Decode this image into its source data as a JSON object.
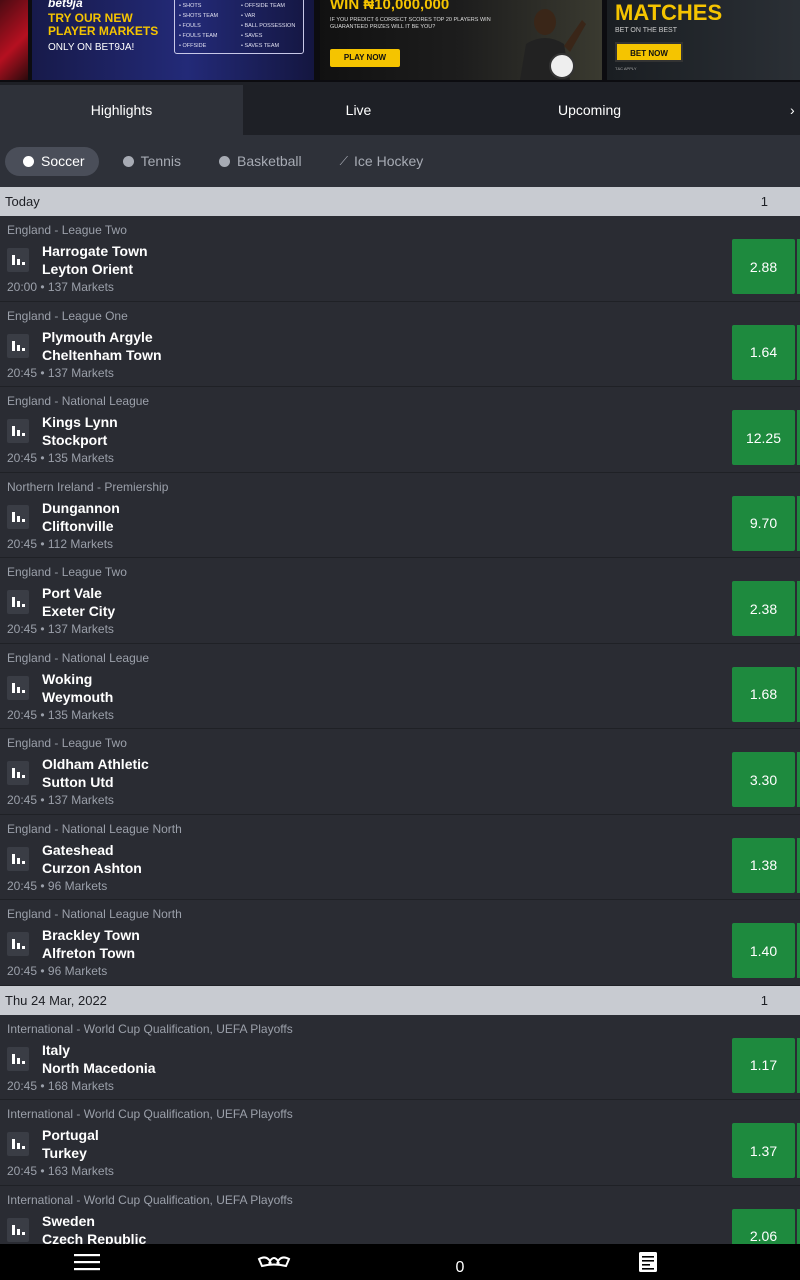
{
  "banner": {
    "ad1": {
      "brand": "bet9ja",
      "headline": "TRY OUR NEW PLAYER MARKETS",
      "subline": "ONLY ON BET9JA!",
      "markets": [
        "• SHOTS",
        "• OFFSIDE TEAM",
        "• SHOTS TEAM",
        "• VAR",
        "• FOULS",
        "• BALL POSSESSION",
        "• FOULS TEAM",
        "• SAVES",
        "• OFFSIDE",
        "• SAVES TEAM"
      ]
    },
    "ad2": {
      "headline": "WIN ₦10,000,000",
      "subline": "IF YOU PREDICT 6 CORRECT SCORES TOP 20 PLAYERS WIN GUARANTEED PRIZES WILL IT BE YOU?",
      "cta": "PLAY NOW"
    },
    "ad3": {
      "headline": "MATCHES",
      "subline": "BET ON THE BEST",
      "cta": "BET NOW",
      "fine_print": "T&C APPLY"
    }
  },
  "tabs": [
    "Highlights",
    "Live",
    "Upcoming"
  ],
  "sports": [
    {
      "label": "Soccer",
      "icon": "soccer-ball-icon"
    },
    {
      "label": "Tennis",
      "icon": "tennis-ball-icon"
    },
    {
      "label": "Basketball",
      "icon": "basketball-icon"
    },
    {
      "label": "Ice Hockey",
      "icon": "hockey-stick-icon"
    }
  ],
  "groups": [
    {
      "date": "Today",
      "col": "1",
      "matches": [
        {
          "league": "England - League Two",
          "home": "Harrogate Town",
          "away": "Leyton Orient",
          "meta": "20:00 • 137 Markets",
          "odd": "2.88"
        },
        {
          "league": "England - League One",
          "home": "Plymouth Argyle",
          "away": "Cheltenham Town",
          "meta": "20:45 • 137 Markets",
          "odd": "1.64"
        },
        {
          "league": "England - National League",
          "home": "Kings Lynn",
          "away": "Stockport",
          "meta": "20:45 • 135 Markets",
          "odd": "12.25"
        },
        {
          "league": "Northern Ireland - Premiership",
          "home": "Dungannon",
          "away": "Cliftonville",
          "meta": "20:45 • 112 Markets",
          "odd": "9.70"
        },
        {
          "league": "England - League Two",
          "home": "Port Vale",
          "away": "Exeter City",
          "meta": "20:45 • 137 Markets",
          "odd": "2.38"
        },
        {
          "league": "England - National League",
          "home": "Woking",
          "away": "Weymouth",
          "meta": "20:45 • 135 Markets",
          "odd": "1.68"
        },
        {
          "league": "England - League Two",
          "home": "Oldham Athletic",
          "away": "Sutton Utd",
          "meta": "20:45 • 137 Markets",
          "odd": "3.30"
        },
        {
          "league": "England - National League North",
          "home": "Gateshead",
          "away": "Curzon Ashton",
          "meta": "20:45 • 96 Markets",
          "odd": "1.38"
        },
        {
          "league": "England - National League North",
          "home": "Brackley Town",
          "away": "Alfreton Town",
          "meta": "20:45 • 96 Markets",
          "odd": "1.40"
        }
      ]
    },
    {
      "date": "Thu 24 Mar, 2022",
      "col": "1",
      "matches": [
        {
          "league": "International - World Cup Qualification, UEFA Playoffs",
          "home": "Italy",
          "away": "North Macedonia",
          "meta": "20:45 • 168 Markets",
          "odd": "1.17"
        },
        {
          "league": "International - World Cup Qualification, UEFA Playoffs",
          "home": "Portugal",
          "away": "Turkey",
          "meta": "20:45 • 163 Markets",
          "odd": "1.37"
        },
        {
          "league": "International - World Cup Qualification, UEFA Playoffs",
          "home": "Sweden",
          "away": "Czech Republic",
          "meta": "",
          "odd": "2.06"
        }
      ]
    }
  ],
  "bottom_nav": {
    "items": [
      "menu-icon",
      "betking-logo-icon",
      "betslip-count",
      "bet-history-icon"
    ],
    "betslip_count": "0"
  },
  "colors": {
    "odd_bg": "#1e8a3e",
    "panel": "#2a2c33",
    "header": "#2e3139",
    "date_bar": "#c8cbd1"
  }
}
